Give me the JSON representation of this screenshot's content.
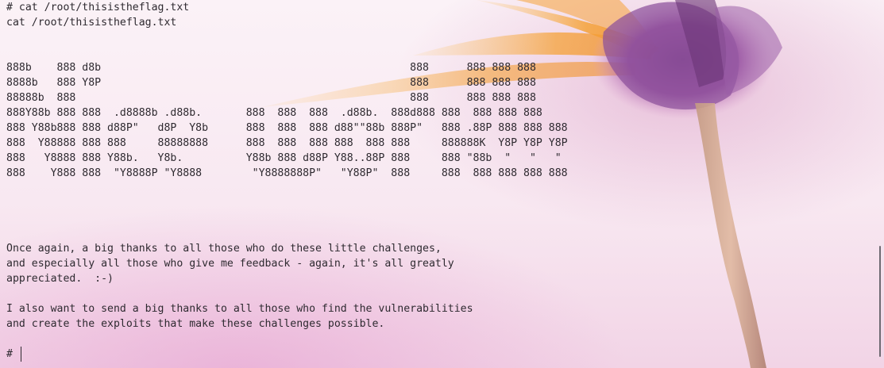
{
  "terminal": {
    "lines": [
      "# cat /root/thisistheflag.txt",
      "cat /root/thisistheflag.txt",
      "",
      "",
      "888b    888 d8b                                                 888      888 888 888",
      "8888b   888 Y8P                                                 888      888 888 888",
      "88888b  888                                                     888      888 888 888",
      "888Y88b 888 888  .d8888b .d88b.       888  888  888  .d88b.  888d888 888  888 888 888",
      "888 Y88b888 888 d88P\"   d8P  Y8b      888  888  888 d88\"\"88b 888P\"   888 .88P 888 888 888",
      "888  Y88888 888 888     88888888      888  888  888 888  888 888     888888K  Y8P Y8P Y8P",
      "888   Y8888 888 Y88b.   Y8b.          Y88b 888 d88P Y88..88P 888     888 \"88b  \"   \"   \"",
      "888    Y888 888  \"Y8888P \"Y8888        \"Y8888888P\"   \"Y88P\"  888     888  888 888 888 888",
      "",
      "",
      "",
      "",
      "Once again, a big thanks to all those who do these little challenges,",
      "and especially all those who give me feedback - again, it's all greatly",
      "appreciated.  :-)",
      "",
      "I also want to send a big thanks to all those who find the vulnerabilities",
      "and create the exploits that make these challenges possible.",
      ""
    ],
    "prompt": "# "
  },
  "theme": {
    "text_color": "#2e2a30",
    "background": "#f8e8f1",
    "petal_orange": "#f39a2a",
    "petal_purple": "#8a4f9a",
    "stem_color": "#b88a78"
  }
}
